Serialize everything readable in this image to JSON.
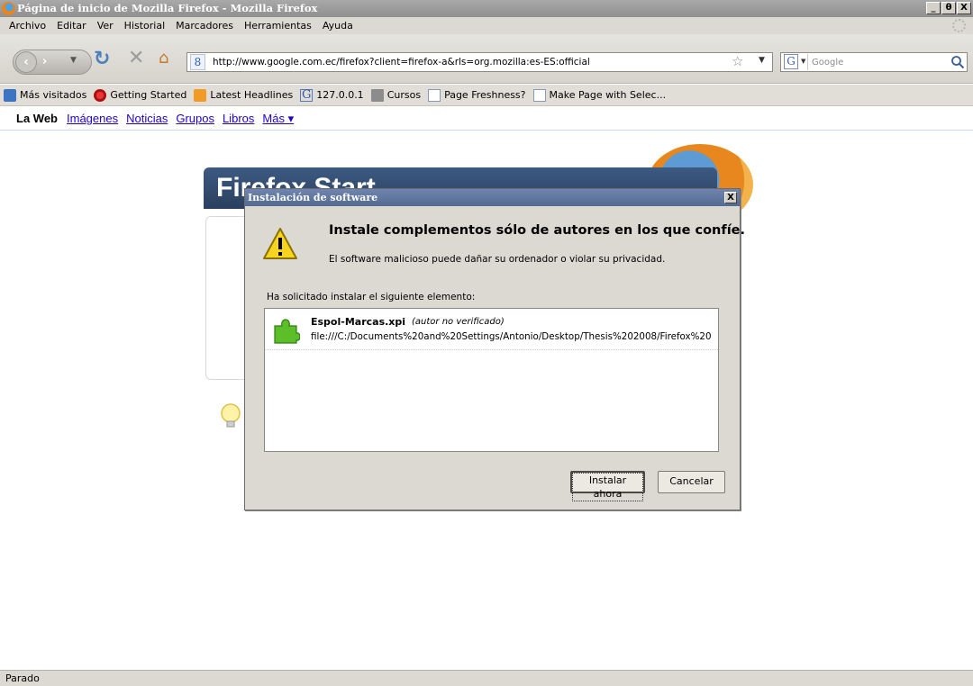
{
  "window": {
    "title": "Página de inicio de Mozilla Firefox - Mozilla Firefox",
    "minimize": "_",
    "maximize": "θ",
    "close": "X"
  },
  "menu": [
    "Archivo",
    "Editar",
    "Ver",
    "Historial",
    "Marcadores",
    "Herramientas",
    "Ayuda"
  ],
  "nav": {
    "url": "http://www.google.com.ec/firefox?client=firefox-a&rls=org.mozilla:es-ES:official",
    "search_placeholder": "Google",
    "site_icon": "8",
    "engine_icon": "G"
  },
  "bookmarks": [
    {
      "label": "Más visitados",
      "icon": "most-visited-icon"
    },
    {
      "label": "Getting Started",
      "icon": "getting-started-icon"
    },
    {
      "label": "Latest Headlines",
      "icon": "rss-icon"
    },
    {
      "label": "127.0.0.1",
      "icon": "g-icon"
    },
    {
      "label": "Cursos",
      "icon": "cursos-icon"
    },
    {
      "label": "Page Freshness?",
      "icon": "page-icon"
    },
    {
      "label": "Make Page with Selec...",
      "icon": "page-icon"
    }
  ],
  "google_links": {
    "current": "La Web",
    "links": [
      "Imágenes",
      "Noticias",
      "Grupos",
      "Libros",
      "Más ▾"
    ]
  },
  "page": {
    "banner_title": "Firefox Start"
  },
  "dialog": {
    "title": "Instalación de software",
    "heading": "Instale complementos sólo de autores en los que confíe.",
    "warning": "El software malicioso puede dañar su ordenador o violar su privacidad.",
    "request": "Ha solicitado instalar el siguiente elemento:",
    "item": {
      "name": "Espol-Marcas.xpi",
      "note": "(autor no verificado)",
      "path": "file:///C:/Documents%20and%20Settings/Antonio/Desktop/Thesis%202008/Firefox%20"
    },
    "install_label": "Instalar ahora",
    "cancel_label": "Cancelar"
  },
  "status": "Parado"
}
